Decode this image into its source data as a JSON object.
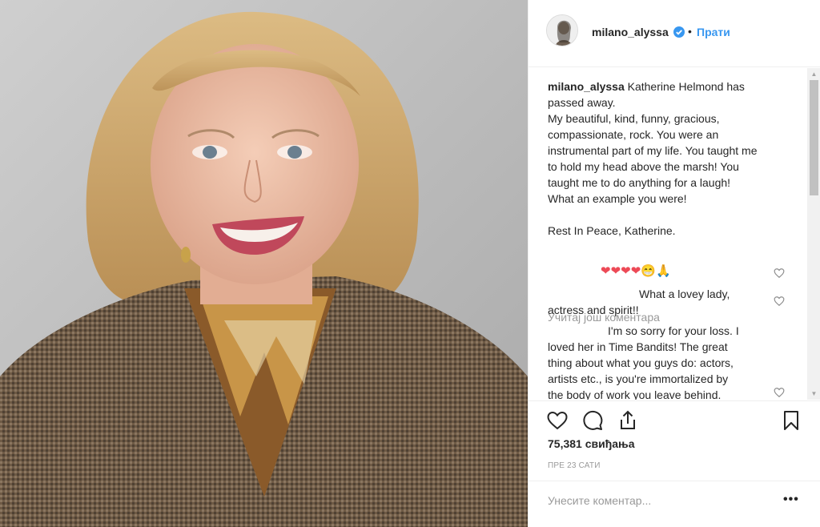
{
  "post": {
    "image_alt": "Katherine Helmond portrait",
    "author": "milano_alyssa",
    "follow_label": "Прати",
    "separator": "•"
  },
  "caption": {
    "username": "milano_alyssa",
    "lines": [
      "Katherine Helmond has",
      "passed away.",
      "My beautiful, kind, funny, gracious,",
      "compassionate, rock. You were an",
      "instrumental part of my life. You taught me",
      "to hold my head above the marsh! You",
      "taught me to do anything for a laugh!",
      "What an example you were!",
      "",
      "Rest In Peace, Katherine."
    ]
  },
  "load_more": "Учитај још коментара",
  "comments": [
    {
      "text": "❤❤❤❤😁🙏"
    },
    {
      "lines": [
        "What a lovey lady,",
        "actress and spirit!!"
      ]
    },
    {
      "lines": [
        "I'm so sorry for your loss. I",
        "loved her in Time Bandits! The great",
        "thing about what you guys do: actors,",
        "artists etc., is you're immortalized by",
        "the body of work you leave behind."
      ]
    }
  ],
  "likes": "75,381 свиђања",
  "time_ago": "ПРЕ 23 САТИ",
  "add_comment_placeholder": "Унесите коментар...",
  "more_label": "•••",
  "icons": [
    "heart-icon",
    "comment-icon",
    "share-icon",
    "bookmark-icon",
    "verified-icon"
  ],
  "colors": {
    "accent": "#3897f0",
    "text": "#262626",
    "muted": "#999999",
    "heart": "#ed4956"
  }
}
